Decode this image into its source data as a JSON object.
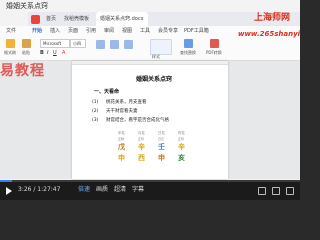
{
  "course": {
    "title": "婚姻关系点窍"
  },
  "app": {
    "tabs": [
      {
        "label": "首页"
      },
      {
        "label": "找稻壳模板"
      },
      {
        "label": "婚姻关系点窍.docx"
      }
    ],
    "menu": [
      "文件",
      "开始",
      "插入",
      "页面",
      "引用",
      "审阅",
      "视图",
      "工具",
      "会员专享",
      "PDF工具箱"
    ],
    "ribbon": {
      "font_name": "Microsoft",
      "font_size": "小四",
      "groups": [
        "格式刷",
        "粘贴",
        "样式",
        "查找替换",
        "PDF转换"
      ]
    }
  },
  "document": {
    "title": "婚姻关系点窍",
    "section": "一、天看命",
    "paragraphs": [
      {
        "num": "(1)",
        "text": "桃花关系，月支查看"
      },
      {
        "num": "(2)",
        "text": "天干财官看夫妻"
      },
      {
        "num": "(3)",
        "text": "财官结合，看宇是否合成化气格"
      }
    ],
    "table": {
      "headers": [
        "年柱",
        "月柱",
        "日柱",
        "时柱"
      ],
      "row1": [
        "戊",
        "辛",
        "壬",
        "辛"
      ],
      "row2": [
        "申",
        "西",
        "申",
        "亥"
      ],
      "captions": [
        "正财",
        "正印",
        "日元",
        "正印"
      ]
    }
  },
  "overlay": {
    "side_text": "易教程",
    "watermark_line1": "上海师网",
    "watermark_line2": "www.265shanyi"
  },
  "player": {
    "time": "3:26 / 1:27:47",
    "buttons": [
      "倍速",
      "画质",
      "超清",
      "字幕"
    ],
    "progress": 0.04,
    "colors": {
      "accent": "#3b7cf5",
      "bar": "#1b1b1b"
    }
  }
}
